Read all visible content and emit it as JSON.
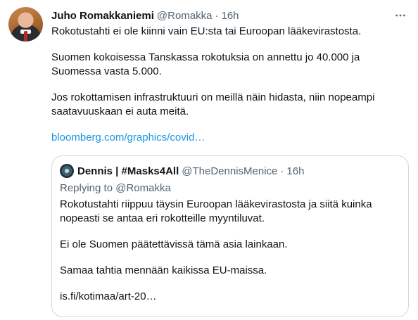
{
  "tweet": {
    "author_name": "Juho Romakkaniemi",
    "handle": "@Romakka",
    "separator": "·",
    "time": "16h",
    "paragraphs": [
      "Rokotustahti ei ole kiinni vain EU:sta tai Euroopan lääkevirastosta.",
      "Suomen kokoisessa Tanskassa rokotuksia on annettu jo 40.000 ja Suomessa vasta 5.000.",
      "Jos rokottamisen infrastruktuuri on meillä näin hidasta, niin nopeampi saatavuuskaan ei auta meitä."
    ],
    "link": "bloomberg.com/graphics/covid…"
  },
  "quote": {
    "author_name": "Dennis | #Masks4All",
    "handle": "@TheDennisMenice",
    "separator": "·",
    "time": "16h",
    "replying_to": "Replying to @Romakka",
    "paragraphs": [
      "Rokotustahti riippuu täysin Euroopan lääkevirastosta ja siitä kuinka nopeasti se antaa eri rokotteille myyntiluvat.",
      "Ei ole Suomen päätettävissä tämä asia lainkaan.",
      "Samaa tahtia mennään kaikissa EU-maissa."
    ],
    "link": "is.fi/kotimaa/art-20…"
  },
  "icons": {
    "more": "more-horizontal-icon"
  },
  "colors": {
    "text": "#0f1419",
    "secondary": "#536471",
    "link": "#1b95e0",
    "border": "#cfd9de"
  }
}
